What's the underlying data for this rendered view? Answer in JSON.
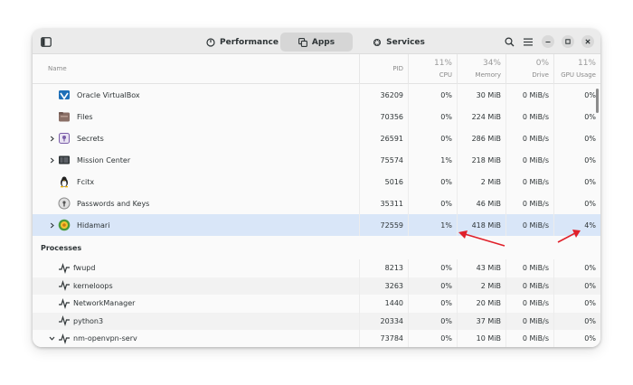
{
  "tabs": [
    {
      "label": "Performance",
      "icon": "gauge-icon"
    },
    {
      "label": "Apps",
      "icon": "apps-icon"
    },
    {
      "label": "Services",
      "icon": "gear-icon"
    }
  ],
  "columns": {
    "name": "Name",
    "pid": "PID",
    "cpu": {
      "pct": "11%",
      "label": "CPU"
    },
    "memory": {
      "pct": "34%",
      "label": "Memory"
    },
    "drive": {
      "pct": "0%",
      "label": "Drive"
    },
    "gpu": {
      "pct": "11%",
      "label": "GPU Usage"
    }
  },
  "apps": [
    {
      "name": "Oracle VirtualBox",
      "pid": "36209",
      "cpu": "0%",
      "memory": "30 MiB",
      "drive": "0 MiB/s",
      "gpu": "0%",
      "expandable": false,
      "icon": "virtualbox-icon"
    },
    {
      "name": "Files",
      "pid": "70356",
      "cpu": "0%",
      "memory": "224 MiB",
      "drive": "0 MiB/s",
      "gpu": "0%",
      "expandable": false,
      "icon": "files-icon"
    },
    {
      "name": "Secrets",
      "pid": "26591",
      "cpu": "0%",
      "memory": "286 MiB",
      "drive": "0 MiB/s",
      "gpu": "0%",
      "expandable": true,
      "icon": "secrets-icon"
    },
    {
      "name": "Mission Center",
      "pid": "75574",
      "cpu": "1%",
      "memory": "218 MiB",
      "drive": "0 MiB/s",
      "gpu": "0%",
      "expandable": true,
      "icon": "mission-center-icon"
    },
    {
      "name": "Fcitx",
      "pid": "5016",
      "cpu": "0%",
      "memory": "2 MiB",
      "drive": "0 MiB/s",
      "gpu": "0%",
      "expandable": false,
      "icon": "penguin-icon"
    },
    {
      "name": "Passwords and Keys",
      "pid": "35311",
      "cpu": "0%",
      "memory": "46 MiB",
      "drive": "0 MiB/s",
      "gpu": "0%",
      "expandable": false,
      "icon": "passwords-keys-icon"
    },
    {
      "name": "Hidamari",
      "pid": "72559",
      "cpu": "1%",
      "memory": "418 MiB",
      "drive": "0 MiB/s",
      "gpu": "4%",
      "expandable": true,
      "selected": true,
      "icon": "hidamari-icon"
    }
  ],
  "processes_header": "Processes",
  "processes": [
    {
      "name": "fwupd",
      "pid": "8213",
      "cpu": "0%",
      "memory": "43 MiB",
      "drive": "0 MiB/s",
      "gpu": "0%",
      "icon": "process-icon"
    },
    {
      "name": "kerneloops",
      "pid": "3263",
      "cpu": "0%",
      "memory": "2 MiB",
      "drive": "0 MiB/s",
      "gpu": "0%",
      "icon": "process-icon"
    },
    {
      "name": "NetworkManager",
      "pid": "1440",
      "cpu": "0%",
      "memory": "20 MiB",
      "drive": "0 MiB/s",
      "gpu": "0%",
      "icon": "process-icon"
    },
    {
      "name": "python3",
      "pid": "20334",
      "cpu": "0%",
      "memory": "37 MiB",
      "drive": "0 MiB/s",
      "gpu": "0%",
      "icon": "process-icon"
    },
    {
      "name": "nm-openvpn-serv",
      "pid": "73784",
      "cpu": "0%",
      "memory": "10 MiB",
      "drive": "0 MiB/s",
      "gpu": "0%",
      "expanded": true,
      "icon": "process-icon"
    }
  ],
  "colors": {
    "selection": "#d9e6f8",
    "annotation_arrow": "#e0202a"
  }
}
